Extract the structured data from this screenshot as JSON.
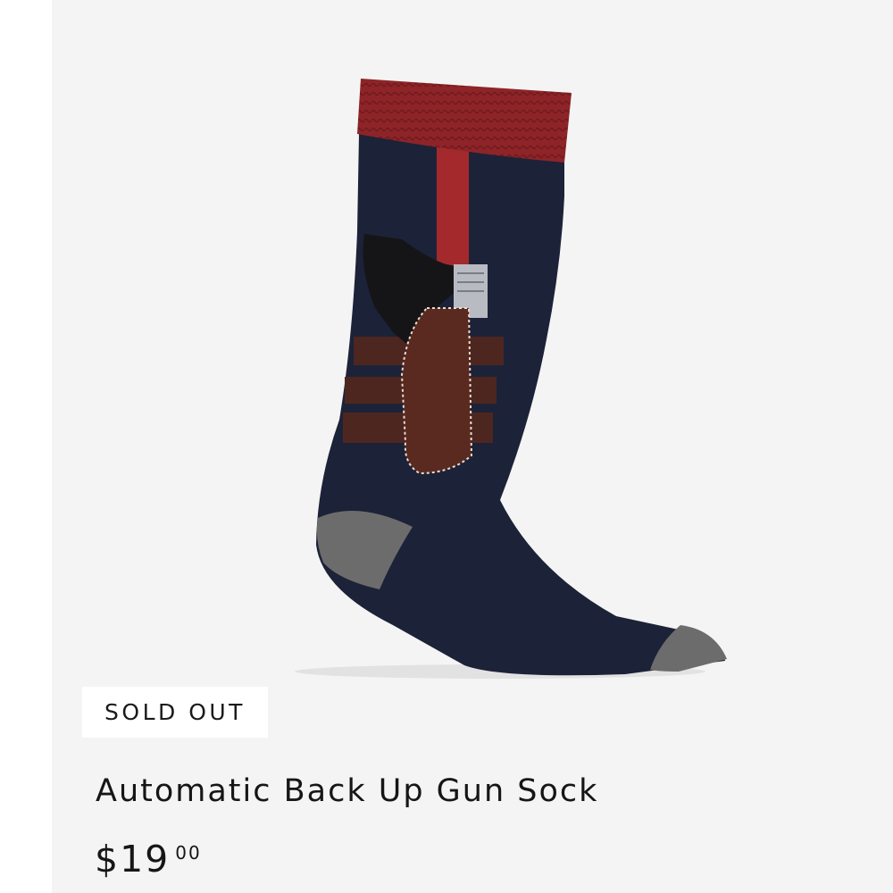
{
  "product": {
    "badge": "SOLD OUT",
    "title": "Automatic Back Up Gun Sock",
    "price_main": "$19",
    "price_cents": "00"
  },
  "image": {
    "alt": "Navy crew sock with red cuff, red vertical stripe, brown holster and belt graphic, gray heel and toe",
    "icon": "product-photo"
  },
  "colors": {
    "sock_navy": "#1c2238",
    "cuff_red": "#8e2428",
    "holster_brown": "#5a2a20",
    "heel_gray": "#6c6c6c",
    "background": "#f4f4f4"
  }
}
